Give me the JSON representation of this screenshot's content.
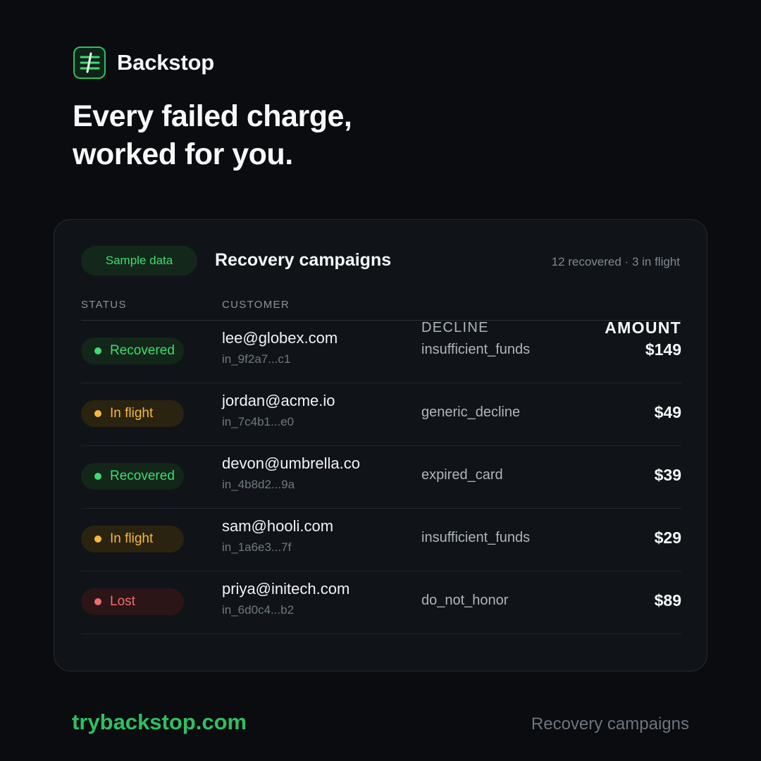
{
  "brand": {
    "name": "Backstop",
    "icon": "backstop-logo-icon",
    "accent_color": "#2fbf63"
  },
  "headline": {
    "line1": "Every failed charge,",
    "line2": "worked for you."
  },
  "card": {
    "badge": "Sample data",
    "title": "Recovery campaigns",
    "summary": "12 recovered · 3 in flight",
    "columns": {
      "status": "STATUS",
      "customer": "CUSTOMER",
      "decline": "DECLINE",
      "amount": "AMOUNT"
    },
    "rows": [
      {
        "status": "Recovered",
        "status_type": "recovered",
        "status_color": "#3ddc73",
        "email": "lee@globex.com",
        "invoice": "in_9f2a7...c1",
        "decline": "insufficient_funds",
        "amount": "$149"
      },
      {
        "status": "In flight",
        "status_type": "inflight",
        "status_color": "#f5b93a",
        "email": "jordan@acme.io",
        "invoice": "in_7c4b1...e0",
        "decline": "generic_decline",
        "amount": "$49"
      },
      {
        "status": "Recovered",
        "status_type": "recovered",
        "status_color": "#3ddc73",
        "email": "devon@umbrella.co",
        "invoice": "in_4b8d2...9a",
        "decline": "expired_card",
        "amount": "$39"
      },
      {
        "status": "In flight",
        "status_type": "inflight",
        "status_color": "#f5b93a",
        "email": "sam@hooli.com",
        "invoice": "in_1a6e3...7f",
        "decline": "insufficient_funds",
        "amount": "$29"
      },
      {
        "status": "Lost",
        "status_type": "lost",
        "status_color": "#f26b6b",
        "email": "priya@initech.com",
        "invoice": "in_6d0c4...b2",
        "decline": "do_not_honor",
        "amount": "$89"
      }
    ]
  },
  "footer": {
    "url": "trybackstop.com",
    "label": "Recovery campaigns"
  }
}
